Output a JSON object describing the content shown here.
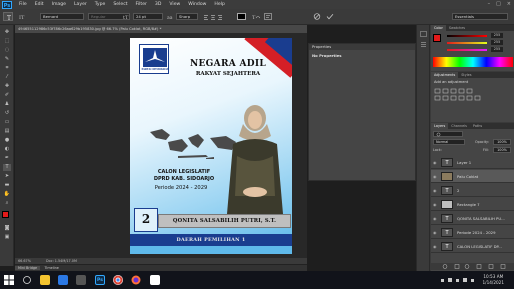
{
  "menubar": {
    "logo": "Ps",
    "items": [
      "File",
      "Edit",
      "Image",
      "Layer",
      "Type",
      "Select",
      "Filter",
      "3D",
      "View",
      "Window",
      "Help"
    ]
  },
  "options": {
    "font_family": "Bernard",
    "font_style": "Regular",
    "font_size": "24 pt",
    "antialias": "Sharp",
    "workspace": "Essentials"
  },
  "document": {
    "tab_title": "494655112986c53f786c26aa629b195830.jpg @ 66.7% (Palu Coklat, RGB/8#) *",
    "zoom": "66.67%",
    "doc_size": "Doc: 1.54M/17.0M"
  },
  "timeline_tabs": [
    "Mini Bridge",
    "Timeline"
  ],
  "poster": {
    "logo_text": "PARTAI DEMOKRAT",
    "tagline_line1": "NEGARA ADIL",
    "tagline_line2": "RAKYAT SEJAHTERA",
    "candidate_line1": "CALON LEGISLATIF",
    "candidate_line2": "DPRD KAB. SIDOARJO",
    "period": "Periode 2024 - 2029",
    "ballot_number": "2",
    "candidate_name": "QONITA SALSABILIH PUTRI, S.T.",
    "district": "DAERAH PEMILIHAN 1",
    "colors": {
      "red": "#d41f26",
      "blue": "#1a3d8f",
      "sky": "#5ab8ea"
    }
  },
  "properties_panel": {
    "title": "Properties",
    "body": "No Properties"
  },
  "right_panels": {
    "color_tabs": [
      "Color",
      "Swatches"
    ],
    "color_values": {
      "r": "255",
      "g": "255",
      "b": "255"
    },
    "adjust_tabs": [
      "Adjustments",
      "Styles"
    ],
    "adjust_title": "Add an adjustment",
    "layers_tabs": [
      "Layers",
      "Channels",
      "Paths"
    ],
    "blend_mode": "Normal",
    "opacity_label": "Opacity:",
    "opacity": "100%",
    "fill_label": "Fill:",
    "fill": "100%",
    "lock_label": "Lock:",
    "layers": [
      {
        "name": "Layer 1",
        "icon": "T",
        "selected": false
      },
      {
        "name": "Palu Coklat",
        "icon": "img",
        "selected": true
      },
      {
        "name": "2",
        "icon": "T",
        "selected": false
      },
      {
        "name": "Rectangle 7",
        "icon": "shape",
        "selected": false
      },
      {
        "name": "QONITA SALSABILIH PU...",
        "icon": "T",
        "selected": false
      },
      {
        "name": "Periode 2024 - 2029",
        "icon": "T",
        "selected": false
      },
      {
        "name": "CALON LEGISLATIF DP...",
        "icon": "T",
        "selected": false
      }
    ]
  },
  "taskbar": {
    "time": "10:53 AM",
    "date": "1/14/2021"
  }
}
